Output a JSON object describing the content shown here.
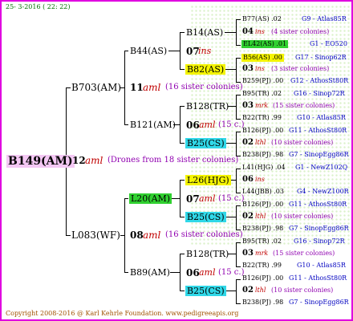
{
  "header": {
    "date": "25-  3-2016 ( 22: 22)"
  },
  "footer": {
    "copyright": "Copyright 2008-2016 @ Karl Kehrle Foundation.   www.pedigreeapis.org"
  },
  "colors": {
    "frame": "#e000e0",
    "red_text": "#c00000",
    "purple_text": "#9000b0",
    "blue_text": "#0000c0",
    "pink": "#f4c8f4",
    "green": "#30d030",
    "yellow": "#f4f400",
    "cyan": "#30d8e8"
  },
  "root": {
    "id": "B149(AM)",
    "gen": "12",
    "race": "aml",
    "note": "(Drones from 18 sister colonies)"
  },
  "level1": [
    {
      "id": "B703(AM)",
      "gen": "11",
      "race": "aml",
      "note": "(16 sister colonies)"
    },
    {
      "id": "L083(WF)",
      "gen": "08",
      "race": "aml",
      "note": "(16 sister colonies)"
    }
  ],
  "level2": [
    {
      "id": "B44(AS)",
      "gen": "07",
      "race": "ins"
    },
    {
      "id": "B121(AM)",
      "gen": "06",
      "race": "aml",
      "note": "(15 c.)"
    },
    {
      "id": "L20(AM)",
      "gen": "07",
      "race": "aml",
      "note": "(15 c.)"
    },
    {
      "id": "B89(AM)",
      "gen": "06",
      "race": "aml",
      "note": "(15 c.)"
    }
  ],
  "level3": [
    {
      "id": "B14(AS)"
    },
    {
      "id": "B82(AS)"
    },
    {
      "id": "B128(TR)"
    },
    {
      "id": "B25(CS)"
    },
    {
      "id": "L26(HJG)"
    },
    {
      "id": "B25(CS)"
    },
    {
      "id": "B128(TR)"
    },
    {
      "id": "B25(CS)"
    }
  ],
  "level4": [
    {
      "a": "B77(AS) .02",
      "a_tag": "G9 - Atlas85R",
      "mid_gen": "04",
      "mid_race": "ins",
      "mid_note": "(4 sister colonies)",
      "b": "EL42(AS) .01",
      "b_tag": "G1 - EO520"
    },
    {
      "a": "B56(AS) .00",
      "a_tag": "G17 - Sinop62R",
      "mid_gen": "03",
      "mid_race": "ins",
      "mid_note": "(3 sister colonies)",
      "b": "B259(PJ) .00",
      "b_tag": "G12 - AthosSt80R"
    },
    {
      "a": "B95(TR) .02",
      "a_tag": "G16 - Sinop72R",
      "mid_gen": "03",
      "mid_race": "mrk",
      "mid_note": "(15 sister colonies)",
      "b": "B22(TR) .99",
      "b_tag": "G10 - Atlas85R"
    },
    {
      "a": "B126(PJ) .00",
      "a_tag": "G11 - AthosSt80R",
      "mid_gen": "02",
      "mid_race": "lthl",
      "mid_note": "(10 sister colonies)",
      "b": "B238(PJ) .98",
      "b_tag": "G7 - SinopEgg86R"
    },
    {
      "a": "L41(HJG) .04",
      "a_tag": "G1 - NewZ102Q",
      "mid_gen": "06",
      "mid_race": "ins",
      "mid_note": "",
      "b": "L44(JBB) .03",
      "b_tag": "G4 - NewZ100R"
    },
    {
      "a": "B126(PJ) .00",
      "a_tag": "G11 - AthosSt80R",
      "mid_gen": "02",
      "mid_race": "lthl",
      "mid_note": "(10 sister colonies)",
      "b": "B238(PJ) .98",
      "b_tag": "G7 - SinopEgg86R"
    },
    {
      "a": "B95(TR) .02",
      "a_tag": "G16 - Sinop72R",
      "mid_gen": "03",
      "mid_race": "mrk",
      "mid_note": "(15 sister colonies)",
      "b": "B22(TR) .99",
      "b_tag": "G10 - Atlas85R"
    },
    {
      "a": "B126(PJ) .00",
      "a_tag": "G11 - AthosSt80R",
      "mid_gen": "02",
      "mid_race": "lthl",
      "mid_note": "(10 sister colonies)",
      "b": "B238(PJ) .98",
      "b_tag": "G7 - SinopEgg86R"
    }
  ]
}
